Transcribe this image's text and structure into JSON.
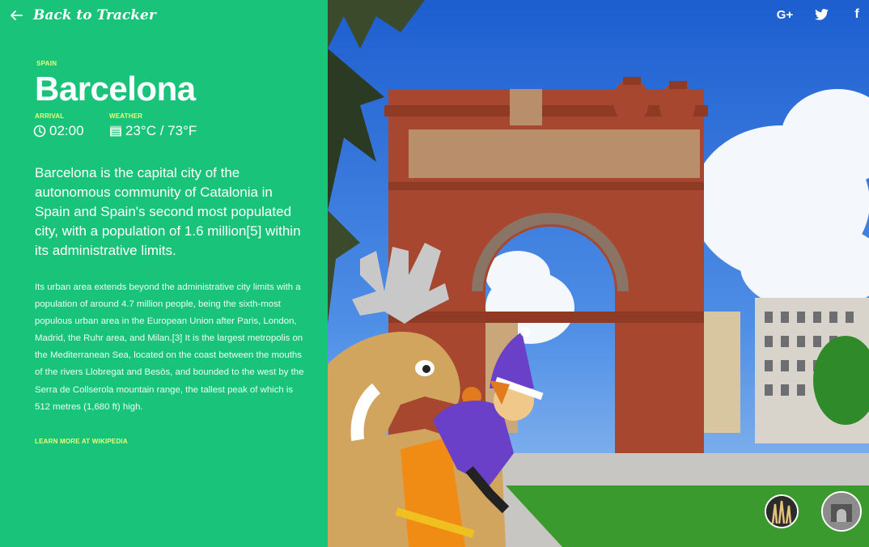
{
  "nav": {
    "back_label": "Back to Tracker"
  },
  "location": {
    "country": "SPAIN",
    "city": "Barcelona",
    "arrival_label": "ARRIVAL",
    "arrival_time": "02:00",
    "weather_label": "WEATHER",
    "weather_value": "23°C / 73°F"
  },
  "description": {
    "lead": "Barcelona is the capital city of the autonomous community of Catalonia in Spain and Spain's second most populated city, with a population of 1.6 million[5] within its administrative limits.",
    "body": "Its urban area extends beyond the administrative city limits with a population of around 4.7 million people, being the sixth-most populous urban area in the European Union after Paris, London, Madrid, the Ruhr area, and Milan.[3] It is the largest metropolis on the Mediterranean Sea, located on the coast between the mouths of the rivers Llobregat and Besòs, and bounded to the west by the Serra de Collserola mountain range, the tallest peak of which is 512 metres (1,680 ft) high.",
    "learn_more": "LEARN MORE AT WIKIPEDIA"
  },
  "social": [
    {
      "name": "google-plus",
      "label": "G+"
    },
    {
      "name": "twitter",
      "label": ""
    },
    {
      "name": "facebook",
      "label": "f"
    }
  ],
  "colors": {
    "panel": "#19c37a",
    "accent": "#e6ff7a",
    "brick": "#a8472f"
  }
}
